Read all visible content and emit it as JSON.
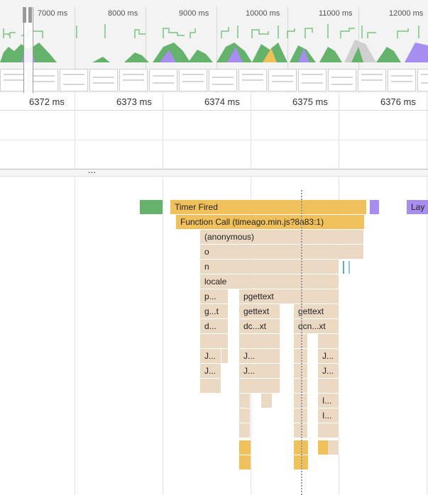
{
  "overview": {
    "ticks": [
      "7000 ms",
      "8000 ms",
      "9000 ms",
      "10000 ms",
      "11000 ms",
      "12000 ms"
    ]
  },
  "ruler": {
    "ticks": [
      "6372 ms",
      "6373 ms",
      "6374 ms",
      "6375 ms",
      "6376 ms"
    ]
  },
  "divider": {
    "label": "..."
  },
  "flame": {
    "timer_fired": "Timer Fired",
    "function_call": "Function Call (timeago.min.js?8a83:1)",
    "anonymous": "(anonymous)",
    "o": "o",
    "n": "n",
    "locale": "locale",
    "p_short": "p...",
    "pgettext": "pgettext",
    "g_t": "g...t",
    "gettext": "gettext",
    "gettext2": "gettext",
    "d_short": "d...",
    "dc_xt": "dc...xt",
    "dcn_xt": "dcn...xt",
    "j1": "J...",
    "j2": "J...",
    "j3": "J...",
    "j4": "J...",
    "j5": "J...",
    "j6": "J...",
    "i1": "I...",
    "i2": "I...",
    "layout": "Lay"
  },
  "colors": {
    "scripting": "#f0c05a",
    "function_frame": "#ecd9c4",
    "painting": "#64b26b",
    "rendering": "#a78df0"
  }
}
